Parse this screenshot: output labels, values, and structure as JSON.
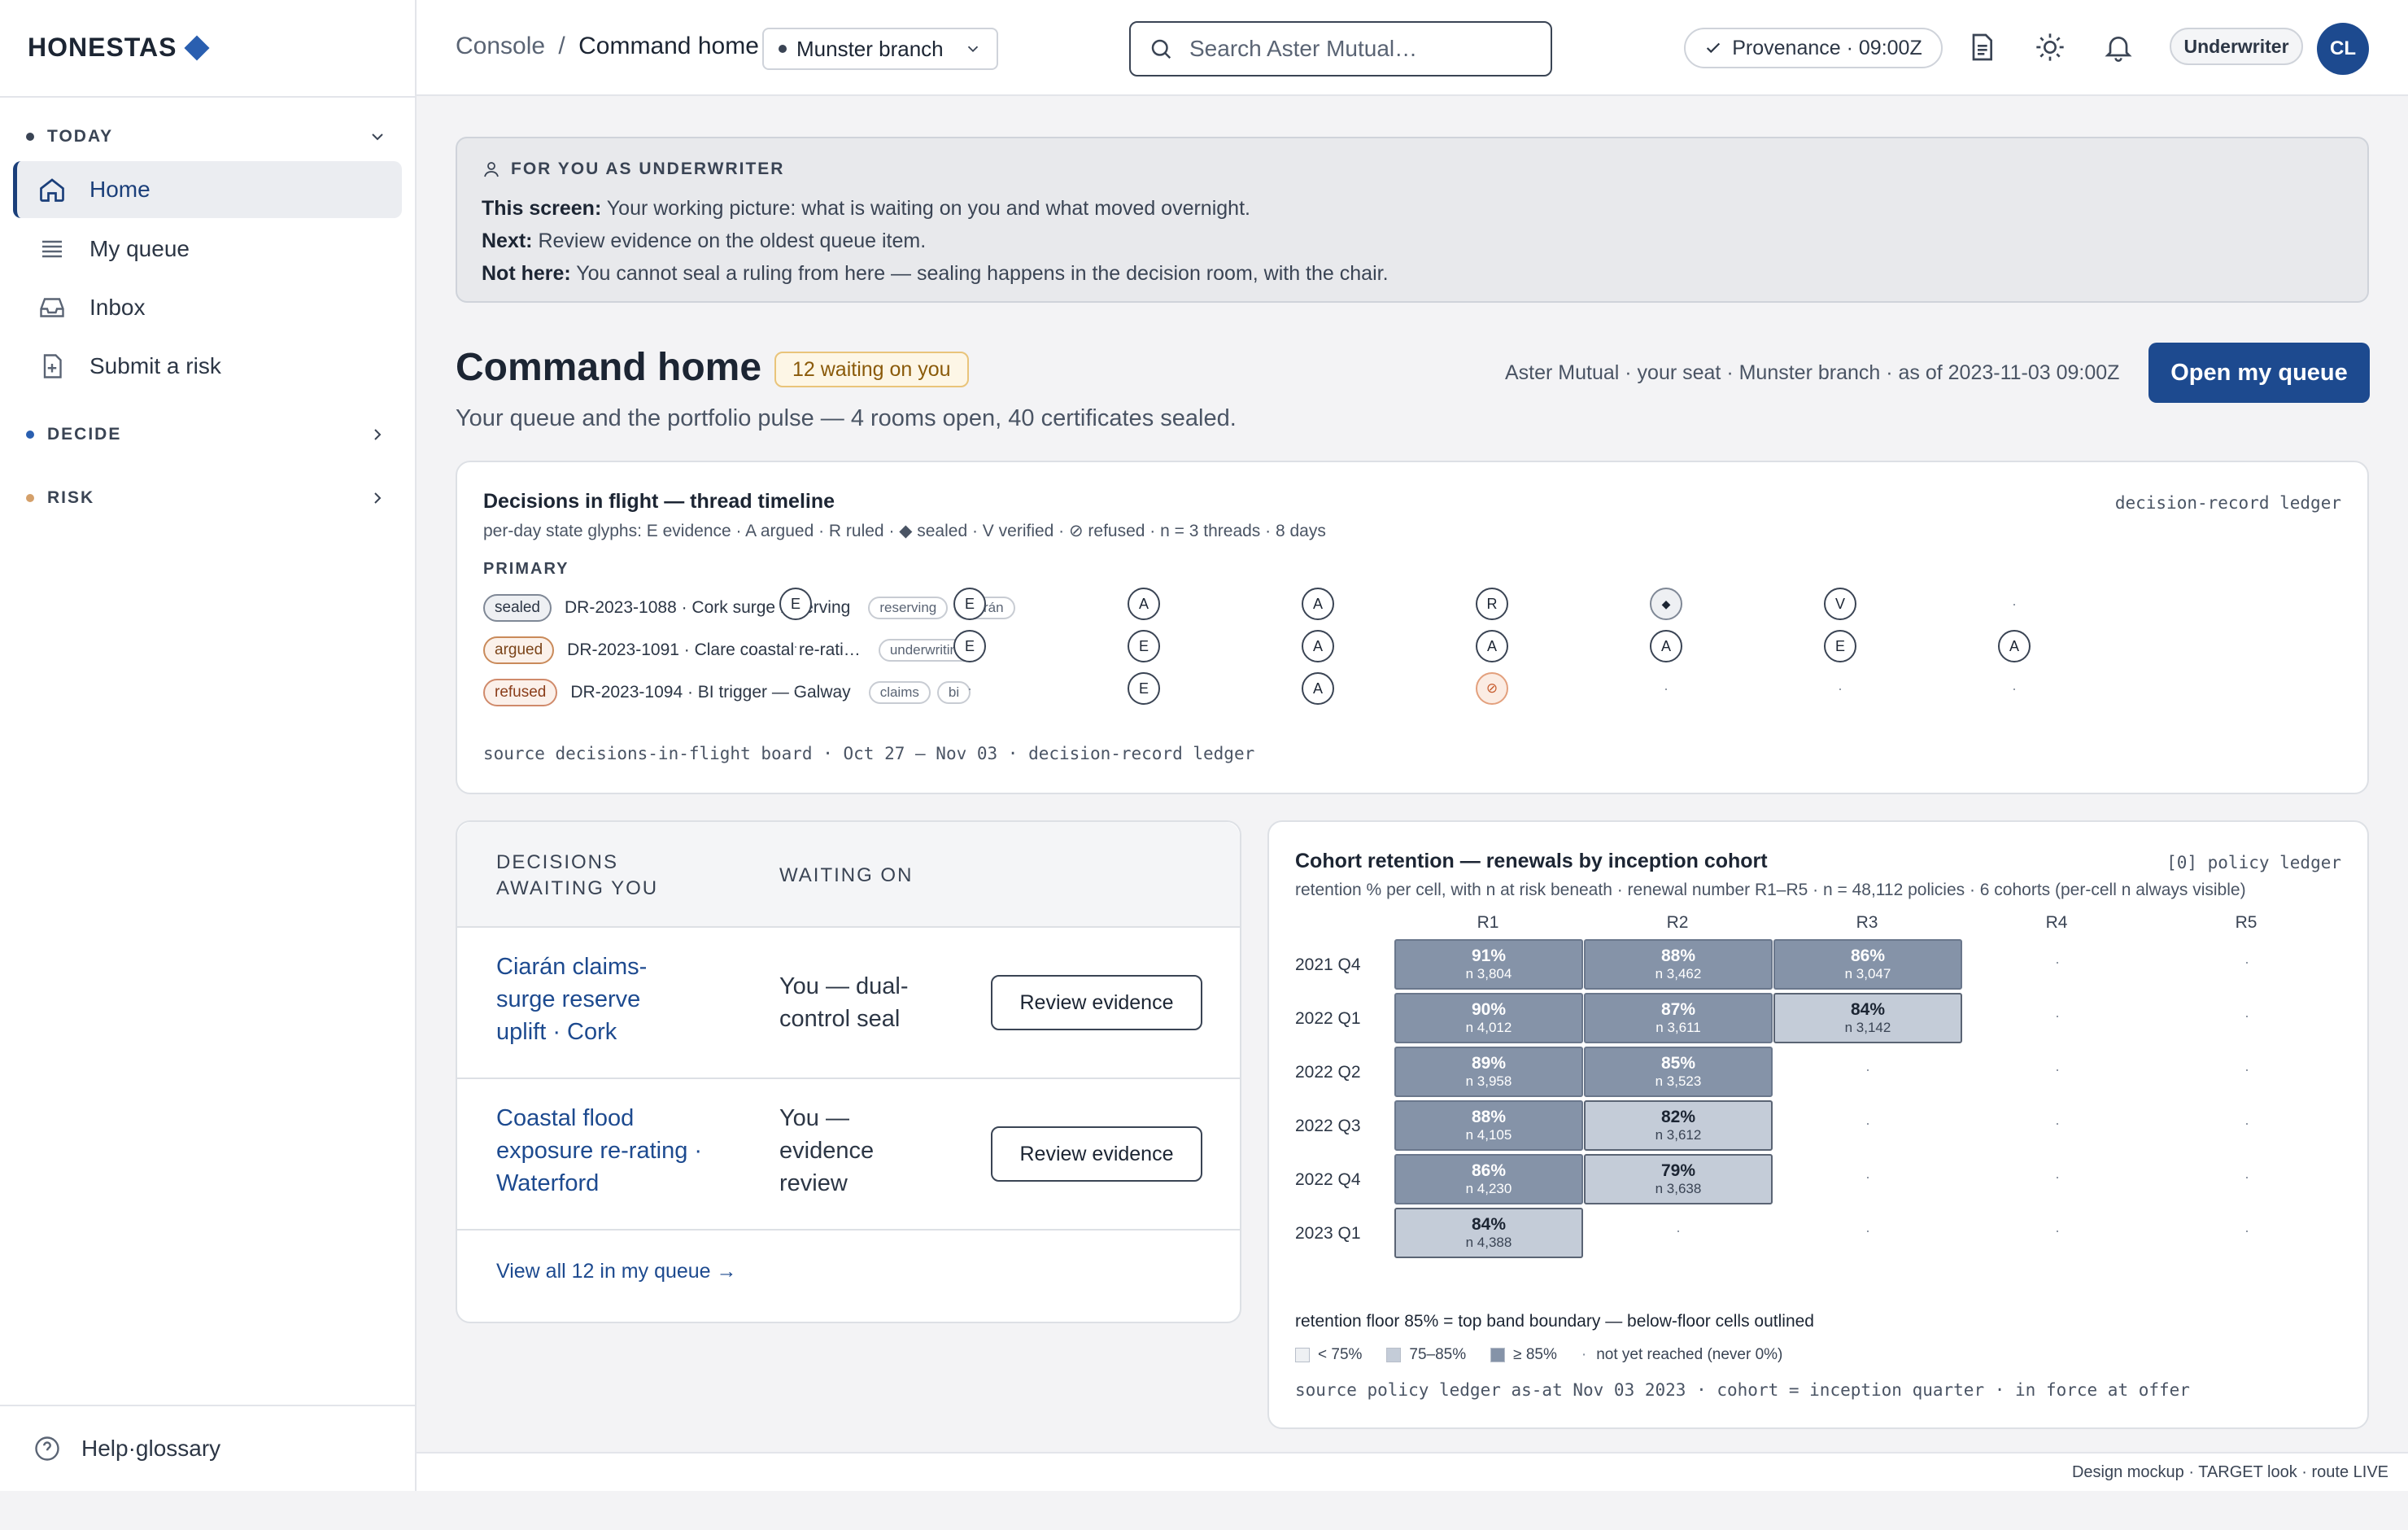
{
  "brand": {
    "name": "HONESTAS"
  },
  "sidebar": {
    "sections": [
      {
        "label": "TODAY",
        "dot_color": "#3a4454"
      },
      {
        "label": "DECIDE",
        "dot_color": "#2a5fb0"
      },
      {
        "label": "RISK",
        "dot_color": "#d4a06a"
      }
    ],
    "items": [
      {
        "label": "Home",
        "icon": "home-icon",
        "active": true
      },
      {
        "label": "My queue",
        "icon": "list-icon"
      },
      {
        "label": "Inbox",
        "icon": "inbox-icon"
      },
      {
        "label": "Submit a risk",
        "icon": "file-plus-icon"
      }
    ],
    "help": "Help·glossary"
  },
  "topbar": {
    "breadcrumb": {
      "root": "Console",
      "sep": "/",
      "current": "Command home"
    },
    "branch": "Munster branch",
    "search_placeholder": "Search Aster Mutual…",
    "provenance": "Provenance · 09:00Z",
    "role": "Underwriter",
    "avatar": "CL"
  },
  "notice": {
    "heading": "FOR YOU AS UNDERWRITER",
    "lines": [
      {
        "label": "This screen:",
        "text": "Your working picture: what is waiting on you and what moved overnight."
      },
      {
        "label": "Next:",
        "text": "Review evidence on the oldest queue item."
      },
      {
        "label": "Not here:",
        "text": "You cannot seal a ruling from here — sealing happens in the decision room, with the chair."
      }
    ]
  },
  "page": {
    "title": "Command home",
    "waiting_badge": "12 waiting on you",
    "meta": "Aster Mutual · your seat · Munster branch · as of 2023-11-03 09:00Z",
    "primary_action": "Open my queue",
    "subtitle": "Your queue and the portfolio pulse — 4 rooms open, 40 certificates sealed."
  },
  "timeline": {
    "title": "Decisions in flight — thread timeline",
    "ledger": "decision-record ledger",
    "subtitle": "per-day state glyphs: E evidence · A argued · R ruled · ◆ sealed · V verified · ⊘ refused · n = 3 threads · 8 days",
    "group": "PRIMARY",
    "rows": [
      {
        "status": "sealed",
        "label": "DR-2023-1088 · Cork surge reserving",
        "tags": [
          "reserving",
          "ciarán"
        ],
        "days": [
          "E",
          "E",
          "A",
          "A",
          "R",
          "◆",
          "V",
          "·"
        ]
      },
      {
        "status": "argued",
        "label": "DR-2023-1091 · Clare coastal re-rati…",
        "tags": [
          "underwriting"
        ],
        "days": [
          "·",
          "E",
          "E",
          "A",
          "A",
          "A",
          "E",
          "A"
        ]
      },
      {
        "status": "refused",
        "label": "DR-2023-1094 · BI trigger — Galway",
        "tags": [
          "claims",
          "bi"
        ],
        "days": [
          "·",
          "·",
          "E",
          "A",
          "⊘",
          "·",
          "·",
          "·"
        ]
      }
    ],
    "source": "source decisions-in-flight board · Oct 27 — Nov 03 · decision-record ledger"
  },
  "queue": {
    "col_decisions": "DECISIONS AWAITING YOU",
    "col_waiting": "WAITING ON",
    "rows": [
      {
        "title": "Ciarán claims-surge reserve uplift · Cork",
        "waiting": "You — dual-control seal",
        "action": "Review evidence"
      },
      {
        "title": "Coastal flood exposure re-rating · Waterford",
        "waiting": "You — evidence review",
        "action": "Review evidence"
      }
    ],
    "view_all": "View all 12 in my queue →"
  },
  "cohort": {
    "title": "Cohort retention — renewals by inception cohort",
    "ledger": "[0] policy ledger",
    "subtitle": "retention % per cell, with n at risk beneath · renewal number R1–R5 · n = 48,112 policies · 6 cohorts (per-cell n always visible)",
    "floor_note": "retention floor 85% = top band boundary — below-floor cells outlined",
    "legend": [
      {
        "label": "< 75%",
        "color": "#eef0f3"
      },
      {
        "label": "75–85%",
        "color": "#c4ccd8"
      },
      {
        "label": "≥ 85%",
        "color": "#8593a8"
      },
      {
        "label": "not yet reached (never 0%)",
        "color": ""
      }
    ],
    "source": "source policy ledger as-at Nov 03 2023 · cohort = inception quarter · in force at offer"
  },
  "chart_data": {
    "type": "heatmap",
    "title": "Cohort retention — renewals by inception cohort",
    "columns": [
      "R1",
      "R2",
      "R3",
      "R4",
      "R5"
    ],
    "rows": [
      "2021 Q4",
      "2022 Q1",
      "2022 Q2",
      "2022 Q3",
      "2022 Q4",
      "2023 Q1"
    ],
    "values": [
      [
        91,
        88,
        86,
        null,
        null
      ],
      [
        90,
        87,
        84,
        null,
        null
      ],
      [
        89,
        85,
        null,
        null,
        null
      ],
      [
        88,
        82,
        null,
        null,
        null
      ],
      [
        86,
        79,
        null,
        null,
        null
      ],
      [
        84,
        null,
        null,
        null,
        null
      ]
    ],
    "n": [
      [
        "3,804",
        "3,462",
        "3,047",
        null,
        null
      ],
      [
        "4,012",
        "3,611",
        "3,142",
        null,
        null
      ],
      [
        "3,958",
        "3,523",
        null,
        null,
        null
      ],
      [
        "4,105",
        "3,612",
        null,
        null,
        null
      ],
      [
        "4,230",
        "3,638",
        null,
        null,
        null
      ],
      [
        "4,388",
        null,
        null,
        null,
        null
      ]
    ],
    "threshold": 85
  },
  "footer": "Design mockup · TARGET look · route LIVE"
}
